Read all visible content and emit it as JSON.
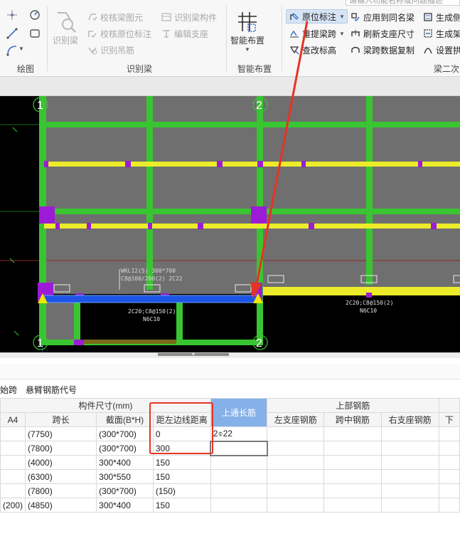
{
  "search": {
    "placeholder": "请输入功能名称或问题描述"
  },
  "ribbon": {
    "groups": [
      {
        "label": "绘图"
      },
      {
        "label": "识别梁"
      },
      {
        "label": "智能布置"
      },
      {
        "label": "梁二次"
      }
    ],
    "identify_beam": "识别梁",
    "check_beam_element": "校核梁图元",
    "identify_beam_member": "识别梁构件",
    "check_original_mark": "校核原位标注",
    "edit_support": "编辑支座",
    "identify_hanger": "识别吊筋",
    "smart_layout": "智能布置",
    "original_mark": "原位标注",
    "apply_same_beam": "应用到同名梁",
    "generate_side": "生成侧",
    "reextract_span": "重提梁跨",
    "refresh_support_size": "刷新支座尺寸",
    "generate_frame": "生成架",
    "check_elevation": "查改标高",
    "copy_span_data": "梁跨数据复制",
    "set_arch": "设置拱"
  },
  "drawing": {
    "axis_1": "1",
    "axis_2": "2",
    "beam_label_line1": "WKL12(5) 300*700",
    "beam_label_line2": "C8@100/200(2) 2C22",
    "rebar_left": "2C20;C8@150(2)",
    "rebar_left_n": "N6C10",
    "rebar_right": "2C20;C8@150(2)",
    "rebar_right_n": "N6C10"
  },
  "table": {
    "toolbar": {
      "start_span": "始跨",
      "cantilever_code": "悬臂钢筋代号"
    },
    "group_headers": {
      "member_size": "构件尺寸(mm)",
      "top_rebar": "上部钢筋"
    },
    "columns": {
      "a4": "A4",
      "span_length": "跨长",
      "section": "截面(B*H)",
      "dist_left_edge": "距左边线距离",
      "top_through": "上通长筋",
      "left_support": "左支座钢筋",
      "mid_span": "跨中钢筋",
      "right_support": "右支座钢筋",
      "next": "下"
    },
    "rows": [
      {
        "a4": "",
        "span": "(7750)",
        "section": "(300*700)",
        "dist": "0",
        "top": "2⌽22"
      },
      {
        "a4": "",
        "span": "(7800)",
        "section": "(300*700)",
        "dist": "300",
        "top": ""
      },
      {
        "a4": "",
        "span": "(4000)",
        "section": "300*400",
        "dist": "150",
        "top": ""
      },
      {
        "a4": "",
        "span": "(6300)",
        "section": "300*550",
        "dist": "150",
        "top": ""
      },
      {
        "a4": "",
        "span": "(7800)",
        "section": "(300*700)",
        "dist": "(150)",
        "top": ""
      },
      {
        "a4": "(200)",
        "span": "(4850)",
        "section": "300*400",
        "dist": "150",
        "top": ""
      }
    ]
  },
  "colors": {
    "beam_green": "#39c531",
    "beam_yellow": "#ecec2a",
    "column_purple": "#9d1bd6",
    "selected_blue": "#1e55e6",
    "annotation_red": "#e63324",
    "header_highlight": "#86b1e8"
  }
}
